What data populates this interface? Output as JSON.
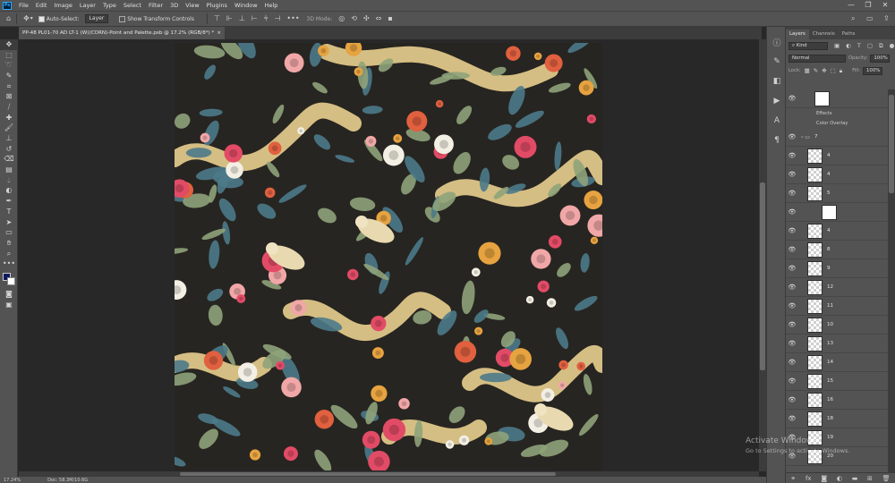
{
  "menubar": {
    "logo": "Ps",
    "items": [
      "File",
      "Edit",
      "Image",
      "Layer",
      "Type",
      "Select",
      "Filter",
      "3D",
      "View",
      "Plugins",
      "Window",
      "Help"
    ],
    "window_controls": [
      "—",
      "❐",
      "✕"
    ]
  },
  "options": {
    "home_icon": "home-icon",
    "auto_select_label": "Auto-Select:",
    "auto_select_value": "Layer",
    "transform_controls_label": "Show Transform Controls",
    "mode_3d": "3D Mode:",
    "more": "•••"
  },
  "document_tab": {
    "title": "PP-48 PL01-70 AD LT-1 (W)(CORN)-Point and Palette.psb @ 17.2% (RGB/8*) *",
    "close": "×"
  },
  "status": {
    "zoom": "17.24%",
    "doc_size": "Doc: 58.3M/10.6G"
  },
  "layers_panel": {
    "tabs": [
      "Layers",
      "Channels",
      "Paths"
    ],
    "filter_label": "Kind",
    "blend_mode": "Normal",
    "opacity_label": "Opacity:",
    "opacity_value": "100%",
    "fill_label": "Fill:",
    "fill_value": "100%",
    "lock_label": "Lock:",
    "effects_label": "Effects",
    "color_overlay_label": "Color Overlay",
    "group_name": "7",
    "layers": [
      "4",
      "4",
      "5",
      "",
      "4",
      "8",
      "9",
      "12",
      "11",
      "10",
      "13",
      "14",
      "15",
      "16",
      "18",
      "19",
      "20"
    ]
  },
  "activation": {
    "title": "Activate Windows",
    "subtitle": "Go to Settings to activate Windows."
  },
  "tools": [
    "move-icon",
    "marquee-icon",
    "lasso-icon",
    "quick-select-icon",
    "crop-icon",
    "frame-icon",
    "eyedropper-icon",
    "spot-heal-icon",
    "brush-icon",
    "stamp-icon",
    "history-brush-icon",
    "eraser-icon",
    "gradient-icon",
    "blur-icon",
    "dodge-icon",
    "pen-icon",
    "type-icon",
    "path-select-icon",
    "shape-icon",
    "hand-icon",
    "zoom-icon",
    "more-tools-icon",
    "color-swatches-icon",
    "quick-mask-icon",
    "screen-mode-icon"
  ],
  "colors": {
    "canvas_bg": "#272521",
    "ribbon": "#e9cf8e",
    "rose": "#e24b66",
    "coral": "#e0603f",
    "teal_leaf": "#4c7a8a",
    "sage_leaf": "#8fa37a",
    "blush": "#f1a7a7"
  }
}
